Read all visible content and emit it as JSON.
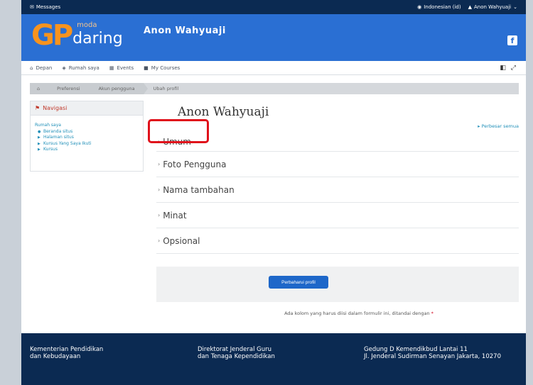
{
  "topbar": {
    "messages": "Messages",
    "language": "Indonesian (id)",
    "user": "Anon Wahyuaji"
  },
  "header": {
    "logo_g": "G",
    "logo_p": "P",
    "logo_moda": "moda",
    "logo_daring": "daring",
    "username": "Anon Wahyuaji",
    "facebook": "f"
  },
  "nav": {
    "items": [
      "Depan",
      "Rumah saya",
      "Events",
      "My Courses"
    ]
  },
  "breadcrumb": [
    "Preferensi",
    "Akun pengguna",
    "Ubah profil"
  ],
  "sidebar": {
    "title": "Navigasi",
    "items": [
      "Rumah saya",
      "Beranda situs",
      "Halaman situs",
      "Kursus Yang Saya Ikuti",
      "Kursus"
    ]
  },
  "main": {
    "title": "Anon Wahyuaji",
    "expand_all": "Perbesar semua",
    "sections": [
      "Umum",
      "Foto Pengguna",
      "Nama tambahan",
      "Minat",
      "Opsional"
    ],
    "submit": "Perbaharui profil",
    "required_note": "Ada kolom yang harus diisi dalam formulir ini, ditandai dengan",
    "required_mark": "*"
  },
  "footer": {
    "col1": [
      "Kementerian Pendidikan",
      "dan Kebudayaan"
    ],
    "col2": [
      "Direktorat Jenderal Guru",
      "dan Tenaga Kependidikan"
    ],
    "col3": [
      "Gedung D Kemendikbud Lantai 11",
      "Jl. Jenderal Sudirman Senayan Jakarta, 10270"
    ]
  },
  "colors": {
    "header_blue": "#2a6fd3",
    "navy": "#0b2a52",
    "logo_orange": "#f7931e",
    "highlight_red": "#e0111b",
    "button_blue": "#1e67c9"
  }
}
